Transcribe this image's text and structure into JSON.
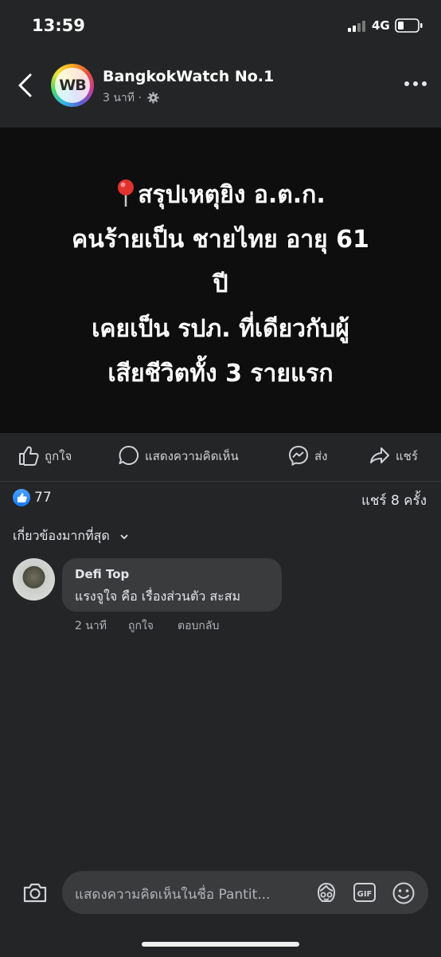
{
  "status_bar": {
    "time": "13:59",
    "network": "4G"
  },
  "header": {
    "page_name": "BangkokWatch No.1",
    "avatar_initials": "WB",
    "timestamp": "3 นาที ·"
  },
  "post": {
    "lines": [
      "สรุปเหตุยิง อ.ต.ก.",
      "คนร้ายเป็น ชายไทย อายุ 61",
      "ปี",
      "เคยเป็น รปภ. ที่เดียวกับผู้",
      "เสียชีวิตทั้ง 3 รายแรก"
    ]
  },
  "actions": {
    "like": "ถูกใจ",
    "comment": "แสดงความคิดเห็น",
    "send": "ส่ง",
    "share": "แชร์"
  },
  "reactions": {
    "like_count": "77",
    "share_count": "แชร์ 8 ครั้ง"
  },
  "comments": {
    "sort_label": "เกี่ยวข้องมากที่สุด",
    "items": [
      {
        "author": "Defi Top",
        "text": "แรงจูใจ คือ เรื่องส่วนตัว สะสม",
        "time": "2 นาที",
        "like": "ถูกใจ",
        "reply": "ตอบกลับ"
      }
    ]
  },
  "composer": {
    "placeholder": "แสดงความคิดเห็นในชื่อ Pantit..."
  },
  "colors": {
    "background": "#242526",
    "post_background": "#0e0e0e",
    "bubble": "#3a3b3c",
    "like_blue": "#1877f2"
  },
  "icons": [
    "back-arrow-icon",
    "gear-icon",
    "more-icon",
    "pin-icon",
    "like-icon",
    "comment-icon",
    "messenger-icon",
    "share-icon",
    "camera-icon",
    "avatar-sticker-icon",
    "gif-icon",
    "emoji-icon"
  ]
}
